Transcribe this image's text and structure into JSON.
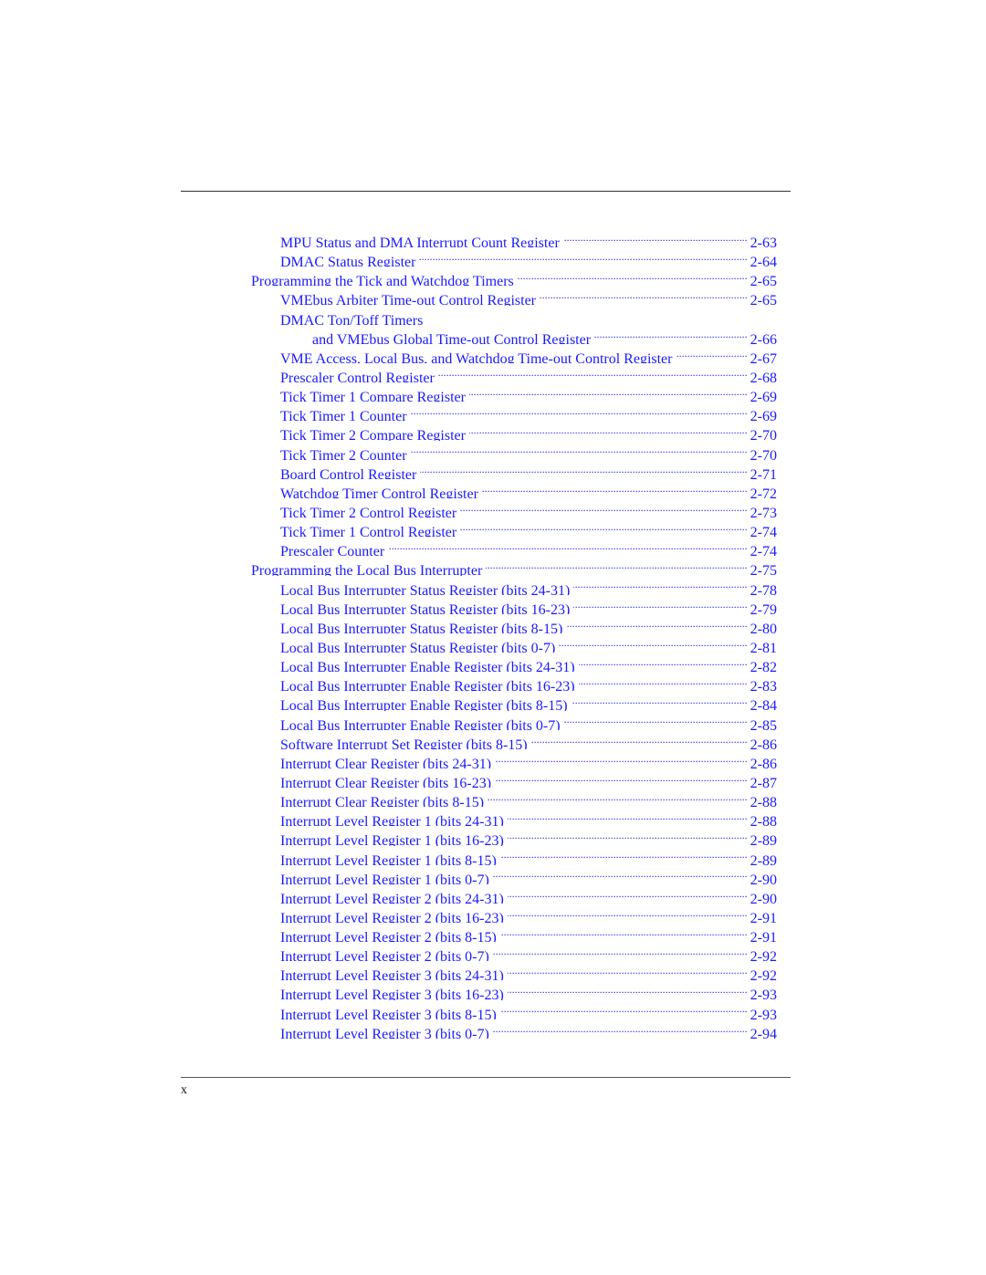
{
  "document": {
    "footer_page_number": "x"
  },
  "toc": {
    "entries": [
      {
        "level": 2,
        "title": "MPU Status and DMA Interrupt Count Register",
        "page": "2-63"
      },
      {
        "level": 2,
        "title": "DMAC Status Register",
        "page": "2-64"
      },
      {
        "level": 1,
        "title": "Programming the Tick and Watchdog Timers",
        "page": "2-65"
      },
      {
        "level": 2,
        "title": "VMEbus Arbiter Time-out Control Register",
        "page": "2-65"
      },
      {
        "level": 2,
        "title": "DMAC Ton/Toff Timers",
        "page": ""
      },
      {
        "level": 3,
        "title": "and VMEbus Global Time-out Control Register",
        "page": "2-66"
      },
      {
        "level": 2,
        "title": "VME Access, Local Bus, and Watchdog Time-out Control Register",
        "page": "2-67"
      },
      {
        "level": 2,
        "title": "Prescaler Control Register",
        "page": "2-68"
      },
      {
        "level": 2,
        "title": "Tick Timer 1 Compare Register",
        "page": "2-69"
      },
      {
        "level": 2,
        "title": "Tick Timer 1 Counter",
        "page": "2-69"
      },
      {
        "level": 2,
        "title": "Tick Timer 2 Compare Register",
        "page": "2-70"
      },
      {
        "level": 2,
        "title": "Tick Timer 2 Counter",
        "page": "2-70"
      },
      {
        "level": 2,
        "title": "Board Control Register",
        "page": "2-71"
      },
      {
        "level": 2,
        "title": "Watchdog Timer Control Register",
        "page": "2-72"
      },
      {
        "level": 2,
        "title": "Tick Timer 2 Control Register",
        "page": "2-73"
      },
      {
        "level": 2,
        "title": "Tick Timer 1 Control Register",
        "page": "2-74"
      },
      {
        "level": 2,
        "title": "Prescaler Counter",
        "page": "2-74"
      },
      {
        "level": 1,
        "title": "Programming the Local Bus Interrupter",
        "page": "2-75"
      },
      {
        "level": 2,
        "title": "Local Bus Interrupter Status Register (bits 24-31)",
        "page": "2-78"
      },
      {
        "level": 2,
        "title": "Local Bus Interrupter Status Register (bits 16-23)",
        "page": "2-79"
      },
      {
        "level": 2,
        "title": "Local Bus Interrupter Status Register (bits 8-15)",
        "page": "2-80"
      },
      {
        "level": 2,
        "title": "Local Bus Interrupter Status Register (bits 0-7)",
        "page": "2-81"
      },
      {
        "level": 2,
        "title": "Local Bus Interrupter Enable Register (bits 24-31)",
        "page": "2-82"
      },
      {
        "level": 2,
        "title": "Local Bus Interrupter Enable Register (bits 16-23)",
        "page": "2-83"
      },
      {
        "level": 2,
        "title": "Local Bus Interrupter Enable Register (bits 8-15)",
        "page": "2-84"
      },
      {
        "level": 2,
        "title": "Local Bus Interrupter Enable Register (bits 0-7)",
        "page": "2-85"
      },
      {
        "level": 2,
        "title": "Software Interrupt Set Register (bits 8-15)",
        "page": "2-86"
      },
      {
        "level": 2,
        "title": "Interrupt Clear Register (bits 24-31)",
        "page": "2-86"
      },
      {
        "level": 2,
        "title": "Interrupt Clear Register (bits 16-23)",
        "page": "2-87"
      },
      {
        "level": 2,
        "title": "Interrupt Clear Register (bits 8-15)",
        "page": "2-88"
      },
      {
        "level": 2,
        "title": "Interrupt Level Register 1 (bits 24-31)",
        "page": "2-88"
      },
      {
        "level": 2,
        "title": "Interrupt Level Register 1 (bits 16-23)",
        "page": "2-89"
      },
      {
        "level": 2,
        "title": "Interrupt Level Register 1 (bits 8-15)",
        "page": "2-89"
      },
      {
        "level": 2,
        "title": "Interrupt Level Register 1 (bits 0-7)",
        "page": "2-90"
      },
      {
        "level": 2,
        "title": "Interrupt Level Register 2 (bits 24-31)",
        "page": "2-90"
      },
      {
        "level": 2,
        "title": "Interrupt Level Register 2 (bits 16-23)",
        "page": "2-91"
      },
      {
        "level": 2,
        "title": "Interrupt Level Register 2 (bits 8-15)",
        "page": "2-91"
      },
      {
        "level": 2,
        "title": "Interrupt Level Register 2 (bits 0-7)",
        "page": "2-92"
      },
      {
        "level": 2,
        "title": "Interrupt Level Register 3 (bits 24-31)",
        "page": "2-92"
      },
      {
        "level": 2,
        "title": "Interrupt Level Register 3 (bits 16-23)",
        "page": "2-93"
      },
      {
        "level": 2,
        "title": "Interrupt Level Register 3 (bits 8-15)",
        "page": "2-93"
      },
      {
        "level": 2,
        "title": "Interrupt Level Register 3 (bits 0-7)",
        "page": "2-94"
      }
    ]
  },
  "colors": {
    "link": "#1a1aff",
    "rule": "#333333",
    "text": "#111111"
  }
}
